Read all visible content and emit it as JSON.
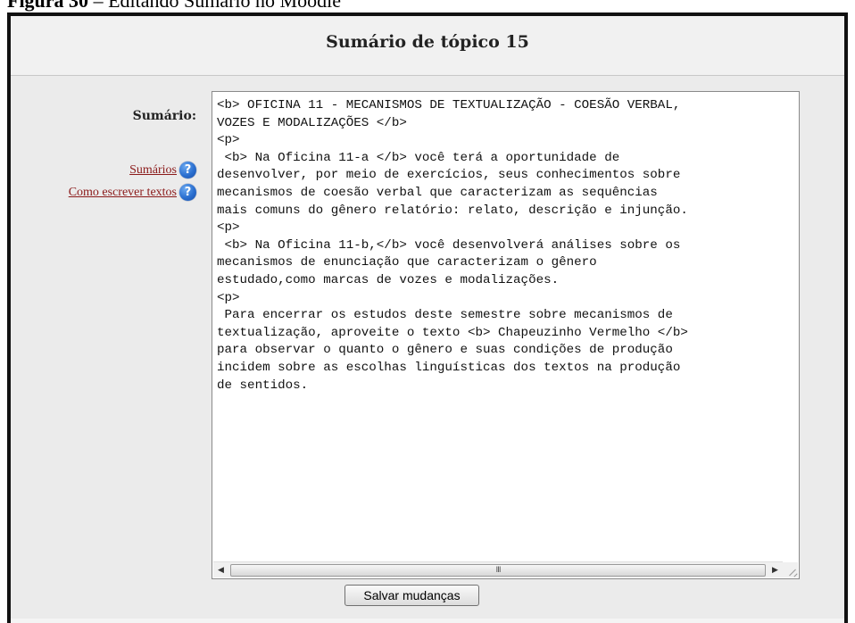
{
  "figure_caption": {
    "label": "Figura 30",
    "text": " – Editando Sumário no Moodle"
  },
  "page": {
    "title": "Sumário de tópico 15"
  },
  "form": {
    "field_label": "Sumário:",
    "help_links": [
      {
        "label": "Sumários",
        "icon": "help-icon"
      },
      {
        "label": "Como escrever textos",
        "icon": "help-icon"
      }
    ],
    "summary_text": "<b> OFICINA 11 - MECANISMOS DE TEXTUALIZAÇÃO - COESÃO VERBAL,\nVOZES E MODALIZAÇÕES </b>\n<p>\n <b> Na Oficina 11-a </b> você terá a oportunidade de\ndesenvolver, por meio de exercícios, seus conhecimentos sobre\nmecanismos de coesão verbal que caracterizam as sequências\nmais comuns do gênero relatório: relato, descrição e injunção.\n<p>\n <b> Na Oficina 11-b,</b> você desenvolverá análises sobre os\nmecanismos de enunciação que caracterizam o gênero\nestudado,como marcas de vozes e modalizações.\n<p>\n Para encerrar os estudos deste semestre sobre mecanismos de\ntextualização, aproveite o texto <b> Chapeuzinho Vermelho </b>\npara observar o quanto o gênero e suas condições de produção\nincidem sobre as escolhas linguísticas dos textos na produção\nde sentidos.",
    "scrollbar_thumb_glyph": "III",
    "save_label": "Salvar mudanças"
  }
}
